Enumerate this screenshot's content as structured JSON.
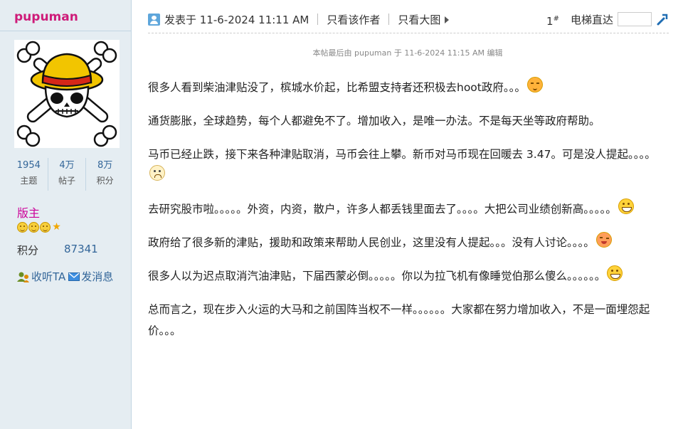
{
  "user": {
    "name": "pupuman",
    "stats": [
      {
        "value": "1954",
        "label": "主题"
      },
      {
        "value": "4万",
        "label": "帖子"
      },
      {
        "value": "8万",
        "label": "积分"
      }
    ],
    "rank": "版主",
    "credit_label": "积分",
    "credit_value": "87341",
    "follow_label": "收听TA",
    "message_label": "发消息"
  },
  "post": {
    "posted_at": "发表于 11-6-2024 11:11 AM",
    "only_author": "只看该作者",
    "only_images": "只看大图",
    "floor": "1",
    "floor_mark": "#",
    "elevator_label": "电梯直达",
    "edited_note": "本帖最后由 pupuman 于 11-6-2024 11:15 AM 编辑",
    "paragraphs": [
      "很多人看到柴油津贴没了，槟城水价起，比希盟支持者还积极去hoot政府。。。",
      "通货膨胀，全球趋势，每个人都避免不了。增加收入，是唯一办法。不是每天坐等政府帮助。",
      "马币已经止跌，接下来各种津贴取消，马币会往上攀。新币对马币现在回暖去 3.47。可是没人提起。。。。",
      "去研究股市啦。。。。。外资，内资，散户，许多人都丢钱里面去了。。。。大把公司业绩创新高。。。。。",
      "政府给了很多新的津贴，援助和政策来帮助人民创业，这里没有人提起。。。没有人讨论。。。。",
      "很多人以为迟点取消汽油津贴，下届西蒙必倒。。。。。你以为拉飞机有像睡觉伯那么傻么。。。。。。",
      "总而言之，现在步入火运的大马和之前国阵当权不一样。。。。。。大家都在努力增加收入，不是一面埋怨起价。。。"
    ]
  }
}
